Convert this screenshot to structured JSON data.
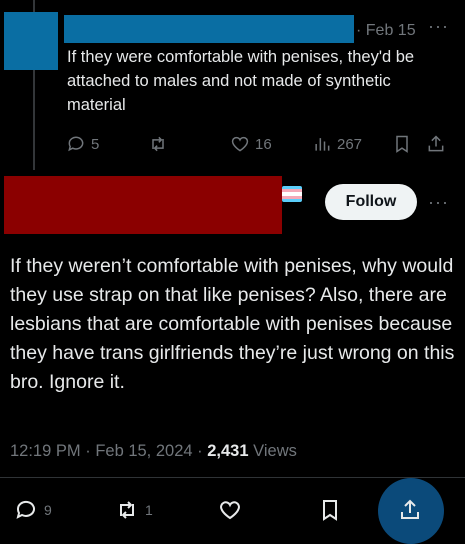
{
  "reply": {
    "date": "· Feb 15",
    "more": "···",
    "text": "If they were comfortable with penises, they'd be attached to males and not made of synthetic material",
    "stats": {
      "replies": "5",
      "likes": "16",
      "views": "267"
    }
  },
  "main": {
    "follow_label": "Follow",
    "more": "···",
    "text": "If they weren’t comfortable with penises, why would they use strap on that like penises? Also, there are lesbians that are comfortable with penises because they have trans girlfriends they’re just wrong on this bro. Ignore it.",
    "time": "12:19 PM",
    "date": "Feb 15, 2024",
    "views_count": "2,431",
    "views_label": "Views",
    "stats": {
      "replies": "9",
      "reposts": "1"
    }
  },
  "colors": {
    "redaction_blue": "#0a6ea3",
    "redaction_red": "#8b0000",
    "flag": [
      "#5bcefa",
      "#f5a9b8",
      "#ffffff",
      "#f5a9b8",
      "#5bcefa"
    ]
  }
}
